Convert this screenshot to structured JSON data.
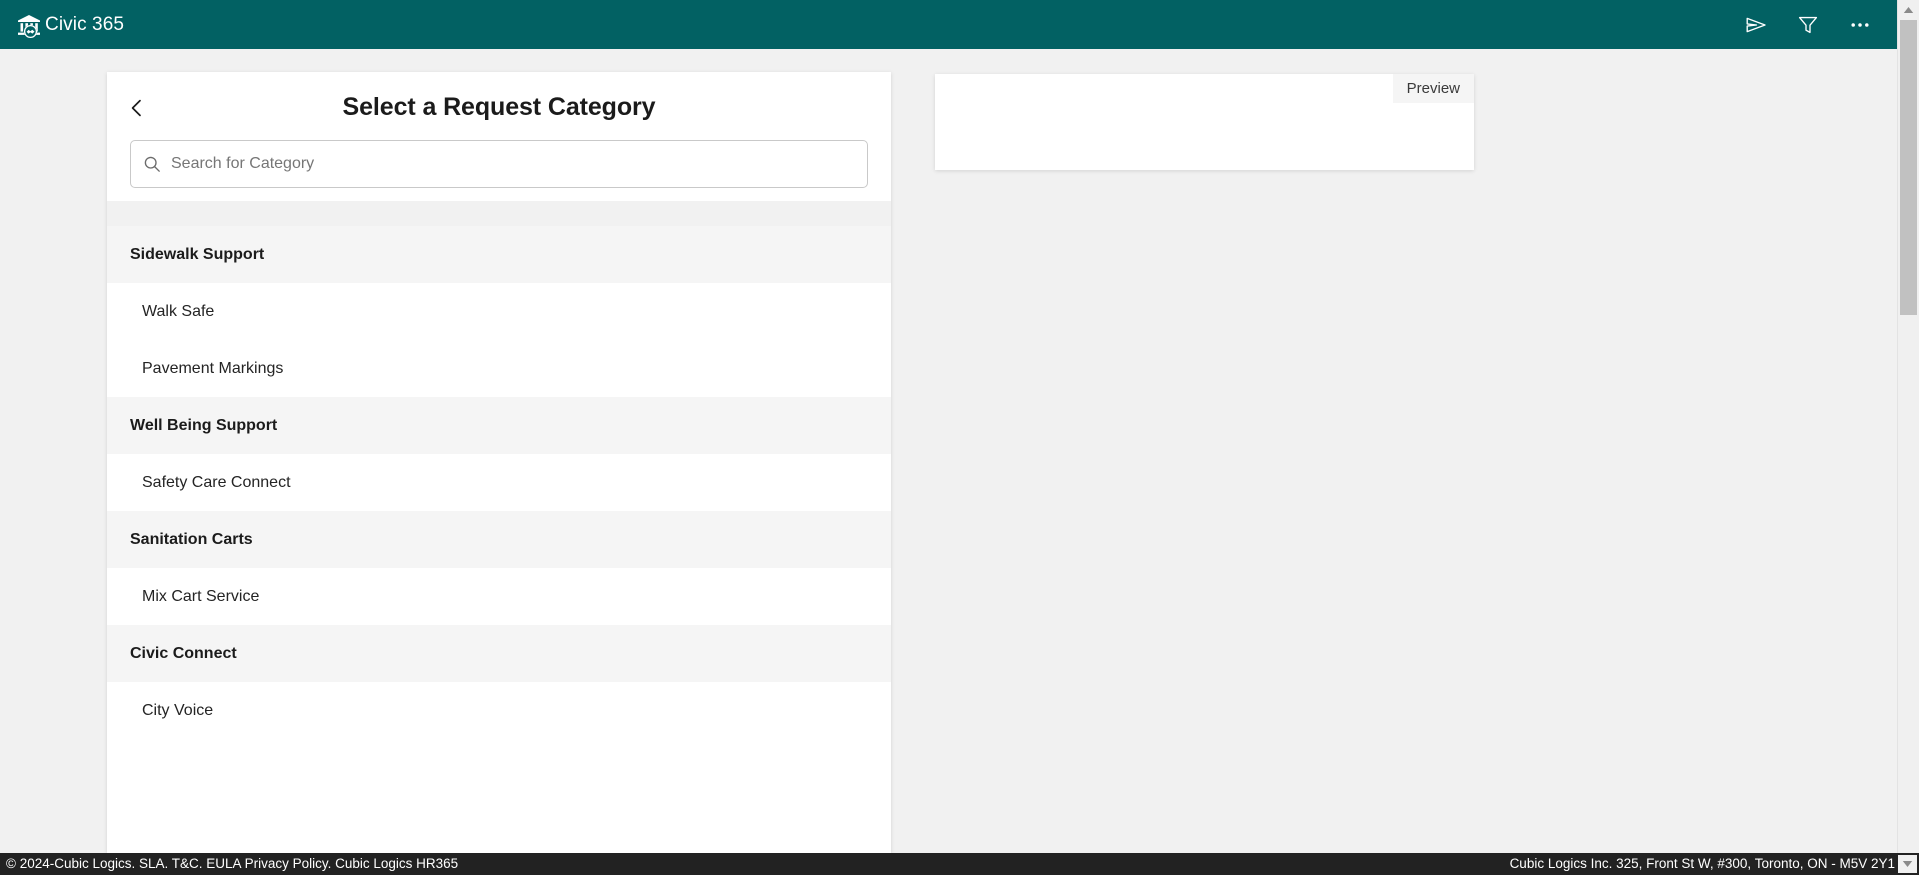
{
  "appbar": {
    "title": "Civic 365",
    "logo_icon": "bank-handshake-icon",
    "actions": [
      {
        "icon": "send-icon",
        "name": "send-button"
      },
      {
        "icon": "filter-icon",
        "name": "filter-button"
      },
      {
        "icon": "ellipsis-icon",
        "name": "more-options-button"
      }
    ]
  },
  "category_panel": {
    "back_icon": "chevron-left-icon",
    "title": "Select a Request Category",
    "search": {
      "icon": "search-icon",
      "value": "",
      "placeholder": "Search for Category"
    },
    "groups": [
      {
        "label": "Sidewalk Support",
        "items": [
          {
            "label": "Walk Safe"
          },
          {
            "label": "Pavement Markings"
          }
        ]
      },
      {
        "label": "Well Being Support",
        "items": [
          {
            "label": "Safety Care Connect"
          }
        ]
      },
      {
        "label": "Sanitation Carts",
        "items": [
          {
            "label": "Mix Cart Service"
          }
        ]
      },
      {
        "label": "Civic Connect",
        "items": [
          {
            "label": "City Voice"
          }
        ]
      }
    ]
  },
  "preview_panel": {
    "tab_label": "Preview"
  },
  "scrollbar": {
    "up_icon": "triangle-up-icon",
    "down_icon": "triangle-down-icon"
  },
  "footer": {
    "left_text": "© 2024-Cubic Logics. SLA. T&C. EULA Privacy Policy. Cubic Logics HR365",
    "right_text": "Cubic Logics Inc. 325, Front St W, #300, Toronto, ON - M5V 2Y1"
  },
  "colors": {
    "brand_teal": "#026163",
    "page_background": "#f1f1f1",
    "group_header_background": "#f5f5f5",
    "footer_background": "#222222",
    "card_background": "#ffffff"
  }
}
